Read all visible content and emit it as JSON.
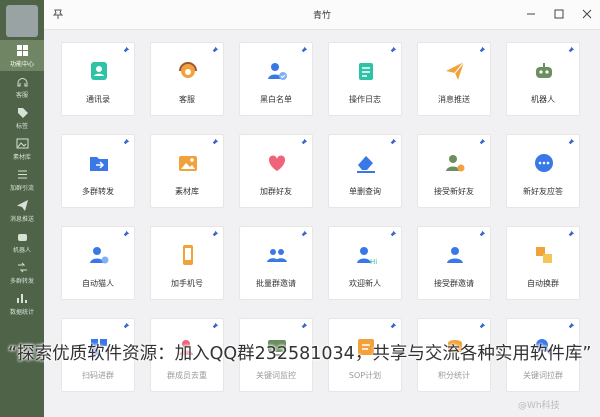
{
  "window": {
    "title": "青竹"
  },
  "sidebar": {
    "items": [
      {
        "label": "功能中心",
        "icon": "grid-icon",
        "active": true
      },
      {
        "label": "客服",
        "icon": "headset-icon"
      },
      {
        "label": "标签",
        "icon": "tag-icon"
      },
      {
        "label": "素材库",
        "icon": "image-icon"
      },
      {
        "label": "加群引流",
        "icon": "flow-icon"
      },
      {
        "label": "消息推送",
        "icon": "send-icon"
      },
      {
        "label": "机器人",
        "icon": "robot-icon"
      },
      {
        "label": "多群转发",
        "icon": "forward-icon"
      },
      {
        "label": "数据统计",
        "icon": "stats-icon"
      }
    ]
  },
  "cards": [
    {
      "label": "通讯录",
      "icon": "contacts-icon",
      "color": "#2ec3a6"
    },
    {
      "label": "客服",
      "icon": "headset-icon",
      "color": "#f2a23a"
    },
    {
      "label": "黑白名单",
      "icon": "user-check-icon",
      "color": "#3a78e8"
    },
    {
      "label": "操作日志",
      "icon": "log-icon",
      "color": "#2ec3a6"
    },
    {
      "label": "消息推送",
      "icon": "send-icon",
      "color": "#f2a23a"
    },
    {
      "label": "机器人",
      "icon": "robot-icon",
      "color": "#6b8f5e"
    },
    {
      "label": "多群转发",
      "icon": "forward-folder-icon",
      "color": "#3a78e8"
    },
    {
      "label": "素材库",
      "icon": "image-icon",
      "color": "#f2a23a"
    },
    {
      "label": "加群好友",
      "icon": "heart-icon",
      "color": "#f0647a"
    },
    {
      "label": "单删查询",
      "icon": "eraser-icon",
      "color": "#3a78e8"
    },
    {
      "label": "接受新好友",
      "icon": "user-accept-icon",
      "color": "#6b8f5e"
    },
    {
      "label": "新好友应答",
      "icon": "chat-bubble-icon",
      "color": "#3a78e8"
    },
    {
      "label": "自动猫人",
      "icon": "user-gear-icon",
      "color": "#3a78e8"
    },
    {
      "label": "加手机号",
      "icon": "phone-icon",
      "color": "#f2a23a"
    },
    {
      "label": "批量群邀请",
      "icon": "group-invite-icon",
      "color": "#3a78e8"
    },
    {
      "label": "欢迎新人",
      "icon": "user-hi-icon",
      "color": "#3a78e8"
    },
    {
      "label": "接受群邀请",
      "icon": "group-accept-icon",
      "color": "#3a78e8"
    },
    {
      "label": "自动换群",
      "icon": "swap-icon",
      "color": "#f2a23a"
    },
    {
      "label": "扫码进群",
      "icon": "qr-icon",
      "color": "#3a78e8"
    },
    {
      "label": "群成员去重",
      "icon": "dedupe-icon",
      "color": "#f0647a"
    },
    {
      "label": "关键词监控",
      "icon": "monitor-icon",
      "color": "#6b8f5e"
    },
    {
      "label": "SOP计划",
      "icon": "plan-icon",
      "color": "#f2a23a"
    },
    {
      "label": "积分统计",
      "icon": "coin-icon",
      "color": "#f2a23a"
    },
    {
      "label": "关键词拉群",
      "icon": "keyword-icon",
      "color": "#3a78e8"
    }
  ],
  "overlay_text": "“探索优质软件资源：加入QQ群232581034，共享与交流各种实用软件库”",
  "watermark": "@Wh科技"
}
